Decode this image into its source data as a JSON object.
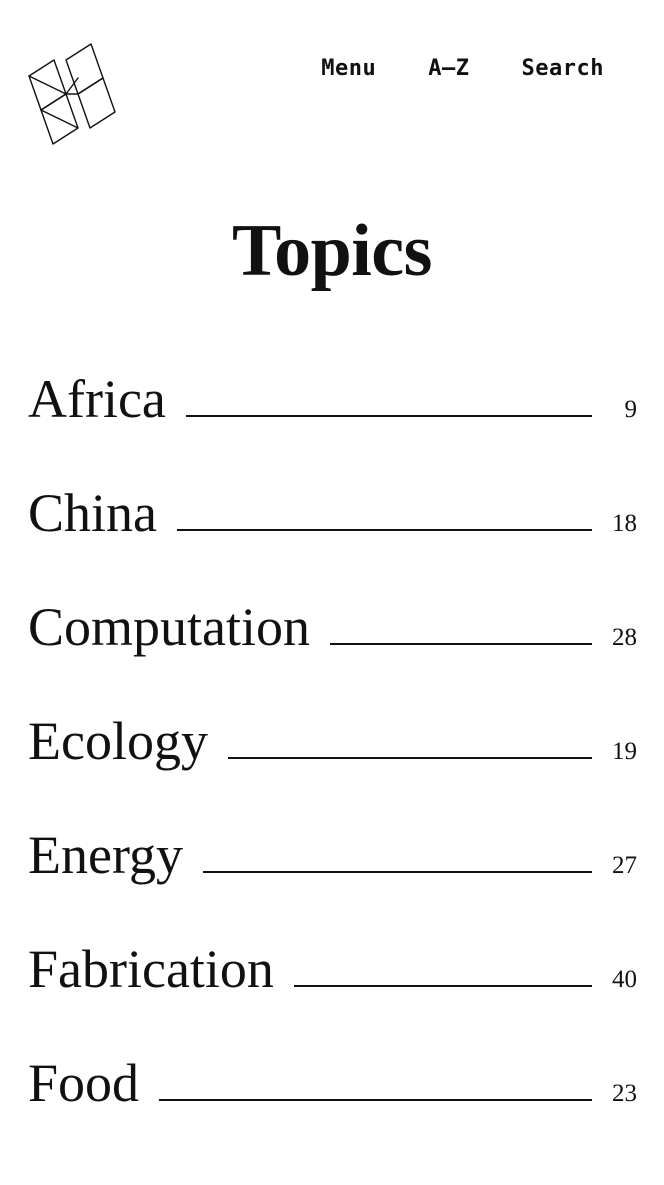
{
  "header": {
    "logo_icon": "lattice-logo-icon",
    "nav": [
      {
        "label": "Menu",
        "name": "menu"
      },
      {
        "label": "A–Z",
        "name": "a-z"
      },
      {
        "label": "Search",
        "name": "search"
      }
    ]
  },
  "main": {
    "title": "Topics",
    "topics": [
      {
        "name": "Africa",
        "count": "9"
      },
      {
        "name": "China",
        "count": "18"
      },
      {
        "name": "Computation",
        "count": "28"
      },
      {
        "name": "Ecology",
        "count": "19"
      },
      {
        "name": "Energy",
        "count": "27"
      },
      {
        "name": "Fabrication",
        "count": "40"
      },
      {
        "name": "Food",
        "count": "23"
      }
    ]
  },
  "colors": {
    "background": "#ffffff",
    "text": "#111111",
    "rule": "#111111"
  }
}
